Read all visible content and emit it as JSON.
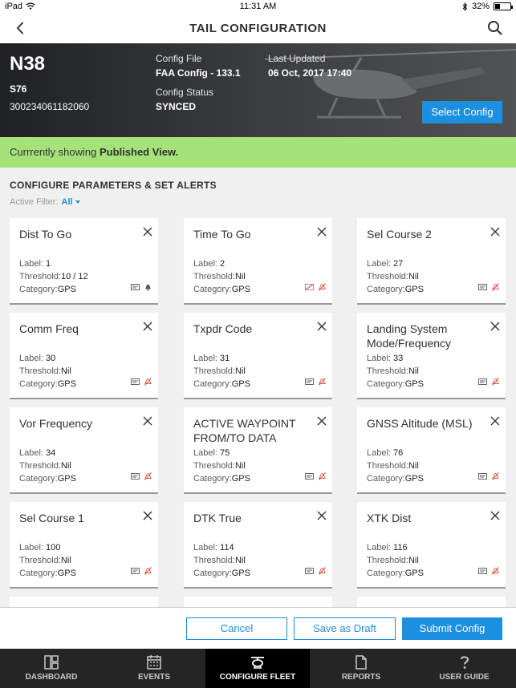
{
  "status_bar": {
    "carrier": "iPad",
    "time": "11:31 AM",
    "battery": "32%",
    "battery_level": 0.32
  },
  "header": {
    "title": "TAIL CONFIGURATION"
  },
  "aircraft": {
    "tail": "N38",
    "model": "S76",
    "serial": "300234061182060",
    "config_file_label": "Config File",
    "config_file": "FAA Config - 133.1",
    "config_status_label": "Config Status",
    "config_status": "SYNCED",
    "last_updated_label": "Last Updated",
    "last_updated": "06 Oct, 2017 17:40",
    "select_config_label": "Select Config"
  },
  "banner": {
    "prefix": "Currrently showing ",
    "view": "Published View."
  },
  "section": {
    "title": "CONFIGURE PARAMETERS & SET ALERTS",
    "filter_label": "Active Filter:",
    "filter_value": "All"
  },
  "cards": [
    {
      "name": "Dist To Go",
      "label": "1",
      "threshold": "10 / 12",
      "category": "GPS",
      "icons": [
        "text-icon",
        "bell-icon"
      ]
    },
    {
      "name": "Time To Go",
      "label": "2",
      "threshold": "Nil",
      "category": "GPS",
      "icons": [
        "text-off-icon",
        "bell-off-icon"
      ]
    },
    {
      "name": "Sel Course 2",
      "label": "27",
      "threshold": "Nil",
      "category": "GPS",
      "icons": [
        "text-icon",
        "bell-off-icon"
      ]
    },
    {
      "name": "Comm Freq",
      "label": "30",
      "threshold": "Nil",
      "category": "GPS",
      "icons": [
        "text-icon",
        "bell-off-icon"
      ]
    },
    {
      "name": "Txpdr Code",
      "label": "31",
      "threshold": "Nil",
      "category": "GPS",
      "icons": [
        "text-icon",
        "bell-off-icon"
      ]
    },
    {
      "name": "Landing System Mode/Frequency",
      "label": "33",
      "threshold": "Nil",
      "category": "GPS",
      "icons": [
        "text-icon",
        "bell-off-icon"
      ]
    },
    {
      "name": "Vor Frequency",
      "label": "34",
      "threshold": "Nil",
      "category": "GPS",
      "icons": [
        "text-icon",
        "bell-off-icon"
      ]
    },
    {
      "name": "ACTIVE WAYPOINT FROM/TO DATA",
      "label": "75",
      "threshold": "Nil",
      "category": "GPS",
      "icons": [
        "text-icon",
        "bell-off-icon"
      ]
    },
    {
      "name": "GNSS Altitude (MSL)",
      "label": "76",
      "threshold": "Nil",
      "category": "GPS",
      "icons": [
        "text-icon",
        "bell-off-icon"
      ]
    },
    {
      "name": "Sel Course 1",
      "label": "100",
      "threshold": "Nil",
      "category": "GPS",
      "icons": [
        "text-icon",
        "bell-off-icon"
      ]
    },
    {
      "name": "DTK True",
      "label": "114",
      "threshold": "Nil",
      "category": "GPS",
      "icons": [
        "text-icon",
        "bell-off-icon"
      ]
    },
    {
      "name": "XTK Dist",
      "label": "116",
      "threshold": "Nil",
      "category": "GPS",
      "icons": [
        "text-icon",
        "bell-off-icon"
      ]
    }
  ],
  "card_labels": {
    "label": "Label: ",
    "threshold": "Threshold:",
    "category": "Category:"
  },
  "actions": {
    "cancel": "Cancel",
    "save_draft": "Save as Draft",
    "submit": "Submit Config"
  },
  "tabs": [
    {
      "label": "DASHBOARD",
      "icon": "dashboard-icon",
      "active": false
    },
    {
      "label": "EVENTS",
      "icon": "calendar-icon",
      "active": false
    },
    {
      "label": "CONFIGURE FLEET",
      "icon": "aircraft-icon",
      "active": true
    },
    {
      "label": "REPORTS",
      "icon": "document-icon",
      "active": false
    },
    {
      "label": "USER GUIDE",
      "icon": "question-icon",
      "active": false
    }
  ],
  "colors": {
    "accent": "#1b8fe0",
    "banner": "#a6e27a",
    "tabbar": "#252525"
  }
}
